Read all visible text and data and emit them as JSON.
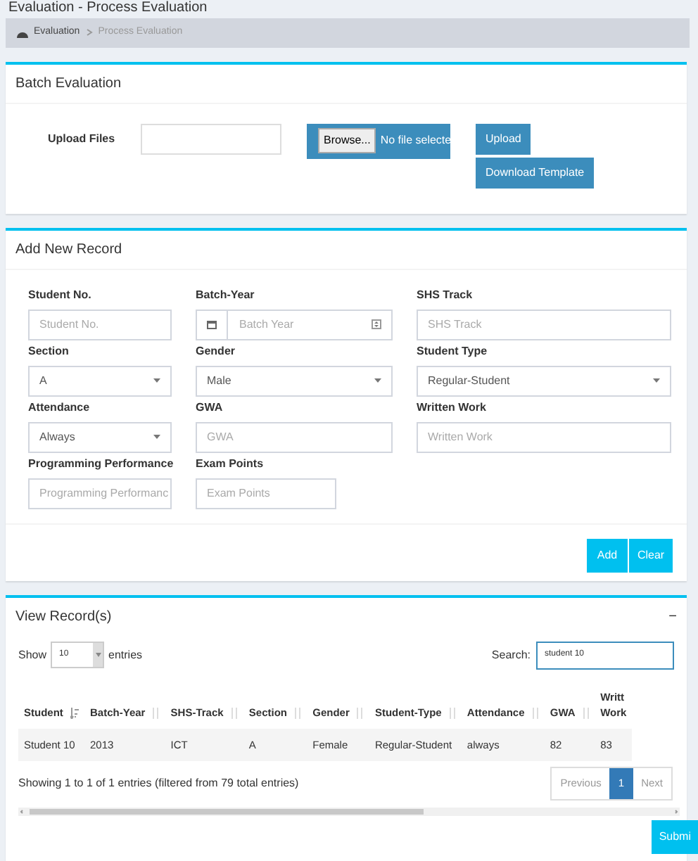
{
  "page_title": "Evaluation - Process Evaluation",
  "breadcrumb": [
    {
      "label": "Evaluation",
      "icon": true
    },
    {
      "label": "Process Evaluation",
      "icon": false
    }
  ],
  "batch": {
    "title": "Batch Evaluation",
    "label": "Upload Files",
    "browse": "Browse...",
    "file_status": "No file selecte",
    "buttons": [
      "Upload",
      "Download Template"
    ]
  },
  "add_record": {
    "title": "Add New Record",
    "fields": [
      {
        "label": "Student No.",
        "kind": "text",
        "placeholder": "Student No."
      },
      {
        "label": "Batch-Year",
        "kind": "date",
        "placeholder": "Batch Year"
      },
      {
        "label": "SHS Track",
        "kind": "text",
        "placeholder": "SHS Track"
      },
      {
        "label": "Section",
        "kind": "select",
        "value": "A"
      },
      {
        "label": "Gender",
        "kind": "select",
        "value": "Male"
      },
      {
        "label": "Student Type",
        "kind": "select",
        "value": "Regular-Student"
      },
      {
        "label": "Attendance",
        "kind": "select",
        "value": "Always"
      },
      {
        "label": "GWA",
        "kind": "text",
        "placeholder": "GWA"
      },
      {
        "label": "Written Work",
        "kind": "text",
        "placeholder": "Written Work"
      },
      {
        "label": "Programming Performance",
        "kind": "text",
        "placeholder": "Programming Performanc"
      },
      {
        "label": "Exam Points",
        "kind": "text",
        "placeholder": "Exam Points"
      }
    ],
    "buttons": [
      "Add",
      "Clear"
    ]
  },
  "records": {
    "title": "View Record(s)",
    "collapse": "−",
    "show_label": "Show",
    "page_size": "10",
    "entries_label": "entries",
    "search_label": "Search:",
    "search_value": "student 10",
    "columns": [
      {
        "label": "Student",
        "sorted": true
      },
      {
        "label": "Batch-Year",
        "sorted": false
      },
      {
        "label": "SHS-Track",
        "sorted": false
      },
      {
        "label": "Section",
        "sorted": false
      },
      {
        "label": "Gender",
        "sorted": false
      },
      {
        "label": "Student-Type",
        "sorted": false
      },
      {
        "label": "Attendance",
        "sorted": false
      },
      {
        "label": "GWA",
        "sorted": false
      },
      {
        "label": "Writt Work"
      }
    ],
    "rows": [
      [
        "Student 10",
        "2013",
        "ICT",
        "A",
        "Female",
        "Regular-Student",
        "always",
        "82",
        "83"
      ]
    ],
    "info": "Showing 1 to 1 of 1 entries (filtered from 79 total entries)",
    "pages": [
      {
        "label": "Previous",
        "selected": false
      },
      {
        "label": "1",
        "selected": true
      },
      {
        "label": "Next",
        "selected": false
      }
    ],
    "submit": "Submi"
  }
}
